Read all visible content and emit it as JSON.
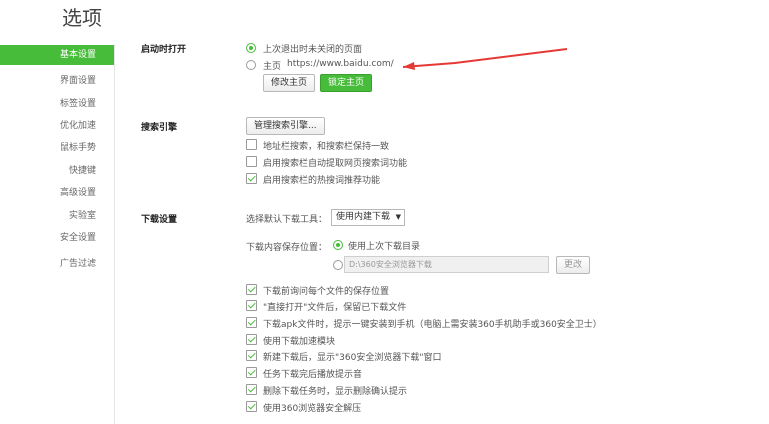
{
  "title": "选项",
  "sidebar": {
    "items": [
      {
        "label": "基本设置",
        "active": true
      },
      {
        "label": "界面设置"
      },
      {
        "label": "标签设置"
      },
      {
        "label": "优化加速"
      },
      {
        "label": "鼠标手势"
      },
      {
        "label": "快捷键"
      },
      {
        "label": "高级设置"
      },
      {
        "label": "实验室"
      },
      {
        "label": "安全设置"
      },
      {
        "label": "广告过滤"
      }
    ]
  },
  "startup": {
    "label": "启动时打开",
    "opt_last": "上次退出时未关闭的页面",
    "opt_home": "主页",
    "home_url": "https://www.baidu.com/",
    "btn_modify": "修改主页",
    "btn_lock": "锁定主页",
    "selected": "last"
  },
  "search": {
    "label": "搜索引擎",
    "btn_manage": "管理搜索引擎...",
    "options": [
      {
        "label": "地址栏搜索，和搜索栏保持一致",
        "checked": false
      },
      {
        "label": "启用搜索栏自动提取网页搜索词功能",
        "checked": false
      },
      {
        "label": "启用搜索栏的热搜词推荐功能",
        "checked": true
      }
    ]
  },
  "download": {
    "label": "下载设置",
    "tool_label": "选择默认下载工具：",
    "tool_value": "使用内建下载",
    "path_label": "下载内容保存位置：",
    "opt_last_dir": "使用上次下载目录",
    "path_value": "D:\\360安全浏览器下载",
    "btn_change": "更改",
    "options": [
      {
        "label": "下载前询问每个文件的保存位置",
        "checked": true
      },
      {
        "label": "\"直接打开\"文件后，保留已下载文件",
        "checked": true
      },
      {
        "label": "下载apk文件时，提示一键安装到手机（电脑上需安装360手机助手或360安全卫士）",
        "checked": true
      },
      {
        "label": "使用下载加速模块",
        "checked": true
      },
      {
        "label": "新建下载后，显示\"360安全浏览器下载\"窗口",
        "checked": true
      },
      {
        "label": "任务下载完后播放提示音",
        "checked": true
      },
      {
        "label": "删除下载任务时，显示删除确认提示",
        "checked": true
      },
      {
        "label": "使用360浏览器安全解压",
        "checked": true
      }
    ]
  },
  "colors": {
    "accent": "#47bb3a",
    "annotation_arrow": "#e53935"
  }
}
